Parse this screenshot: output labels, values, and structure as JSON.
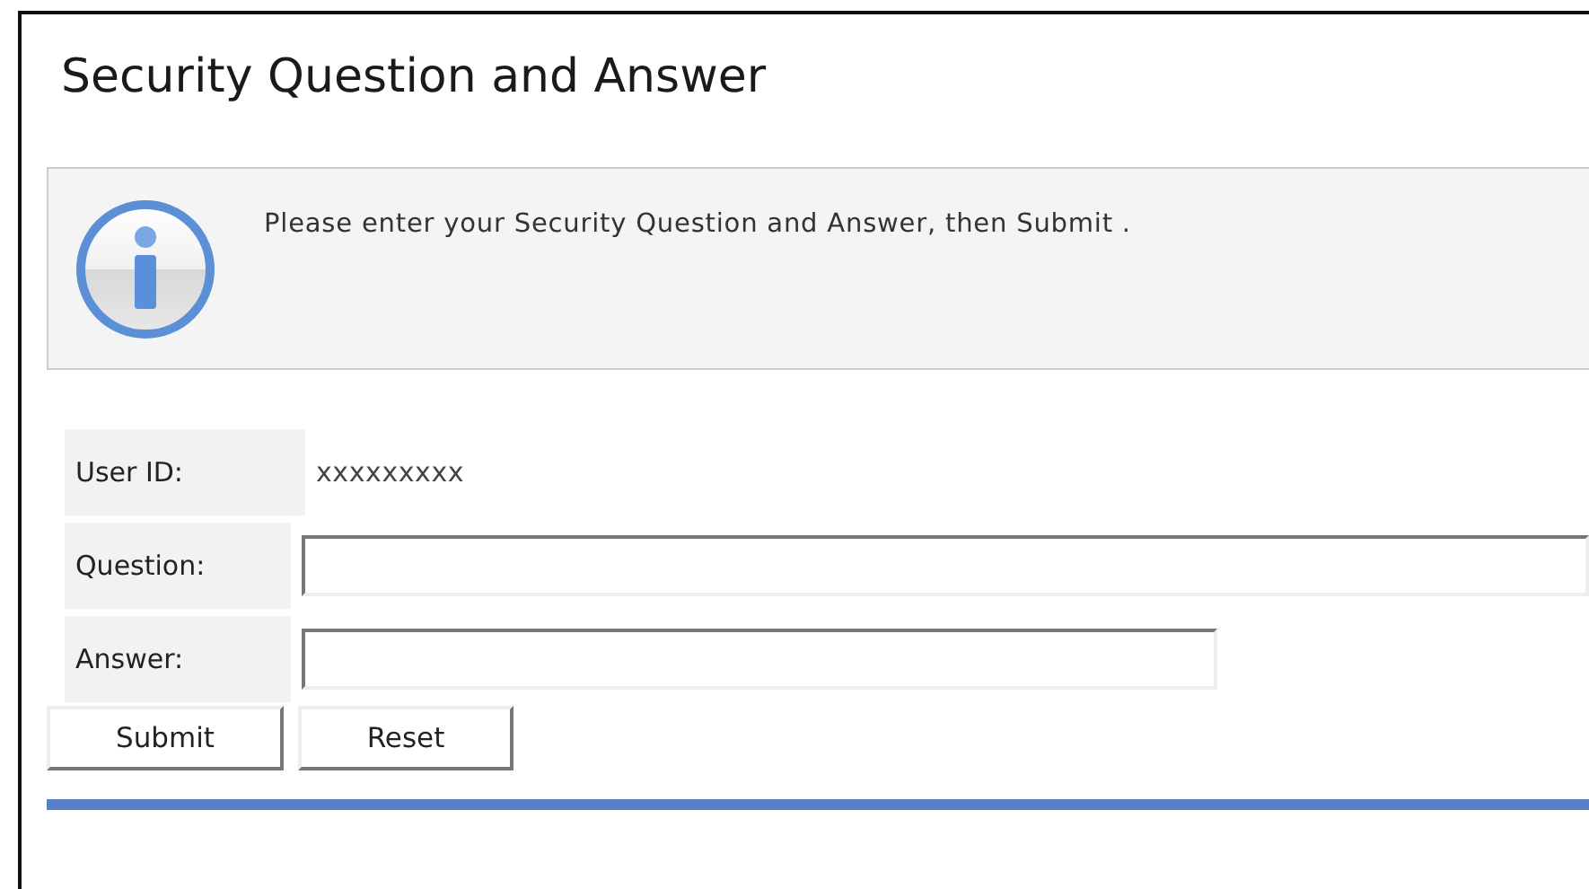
{
  "page": {
    "title": "Security Question and Answer"
  },
  "notice": {
    "text": "Please enter your Security Question and Answer, then Submit ."
  },
  "form": {
    "fields": [
      {
        "kind": "static",
        "label": "User ID:",
        "value": "xxxxxxxxx"
      },
      {
        "kind": "long_input",
        "label": "Question:"
      },
      {
        "kind": "short_input",
        "label": "Answer:"
      }
    ]
  },
  "buttons": [
    "Submit",
    "Reset"
  ]
}
